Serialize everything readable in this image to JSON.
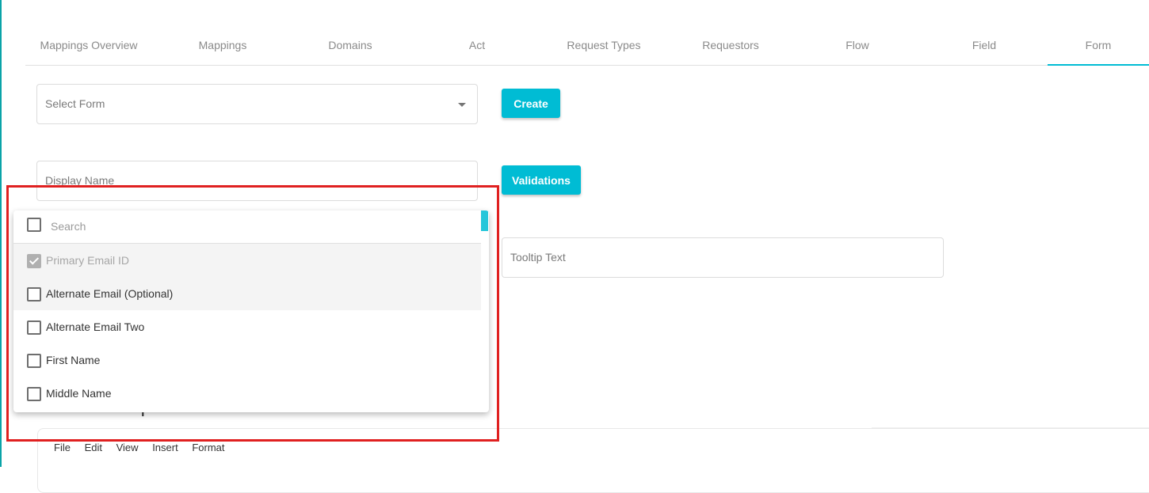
{
  "tabs": [
    {
      "label": "Mappings Overview",
      "active": false
    },
    {
      "label": "Mappings",
      "active": false
    },
    {
      "label": "Domains",
      "active": false
    },
    {
      "label": "Act",
      "active": false
    },
    {
      "label": "Request Types",
      "active": false
    },
    {
      "label": "Requestors",
      "active": false
    },
    {
      "label": "Flow",
      "active": false
    },
    {
      "label": "Field",
      "active": false
    },
    {
      "label": "Form",
      "active": true
    }
  ],
  "form": {
    "select_form_placeholder": "Select Form",
    "create_label": "Create",
    "display_name_placeholder": "Display Name",
    "validations_label": "Validations",
    "tooltip_placeholder": "Tooltip Text",
    "description_title": "Form Description"
  },
  "dropdown": {
    "search_placeholder": "Search",
    "options": [
      {
        "label": "Primary Email ID",
        "checked": true,
        "disabled": true
      },
      {
        "label": "Alternate Email (Optional)",
        "checked": false,
        "disabled": false
      },
      {
        "label": "Alternate Email Two",
        "checked": false,
        "disabled": false
      },
      {
        "label": "First Name",
        "checked": false,
        "disabled": false
      },
      {
        "label": "Middle Name",
        "checked": false,
        "disabled": false
      }
    ]
  },
  "editor": {
    "menu": [
      "File",
      "Edit",
      "View",
      "Insert",
      "Format"
    ]
  },
  "colors": {
    "accent": "#00bcd4",
    "annotation": "#e02020"
  }
}
